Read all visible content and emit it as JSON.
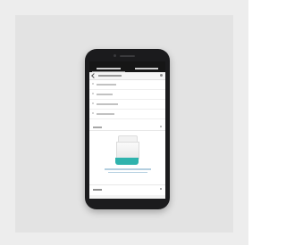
{
  "scene": {
    "description_colors": {
      "background": "#ededed",
      "backdrop": "#e3e3e3",
      "phone_body": "#1b1b1d",
      "accent_product": "#2fb3ad"
    }
  },
  "phone": {
    "app_bar_tabs": 2,
    "menu_rows": 4,
    "icons": [
      "back-arrow-icon",
      "status-dot-icon",
      "add-icon"
    ]
  }
}
